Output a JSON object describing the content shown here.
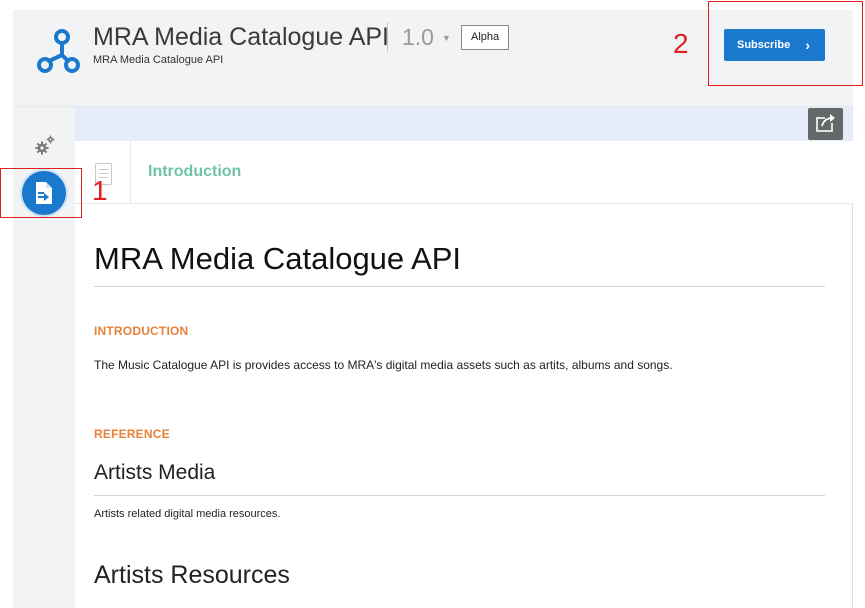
{
  "header": {
    "api_title": "MRA Media Catalogue API",
    "version": "1.0",
    "badge": "Alpha",
    "api_subtitle": "MRA Media Catalogue API",
    "subscribe_label": "Subscribe",
    "subscribe_chevron": "›"
  },
  "colors": {
    "accent_blue": "#1b79cd",
    "intro_green": "#6ec3a8",
    "section_orange": "#e8813a",
    "annotation_red": "#e02020"
  },
  "sidebar": {
    "items": [
      {
        "icon": "gears-icon"
      },
      {
        "icon": "document-icon",
        "active": true
      }
    ]
  },
  "nav": {
    "intro_label": "Introduction"
  },
  "content": {
    "title": "MRA Media Catalogue API",
    "introduction_heading": "INTRODUCTION",
    "introduction_text": "The Music Catalogue API is provides access to MRA's digital media assets such as artits, albums and songs.",
    "reference_heading": "REFERENCE",
    "resources": [
      {
        "title": "Artists Media",
        "description": "Artists related digital media resources."
      },
      {
        "title": "Artists Resources"
      }
    ]
  },
  "annotations": [
    {
      "label": "1"
    },
    {
      "label": "2"
    }
  ]
}
